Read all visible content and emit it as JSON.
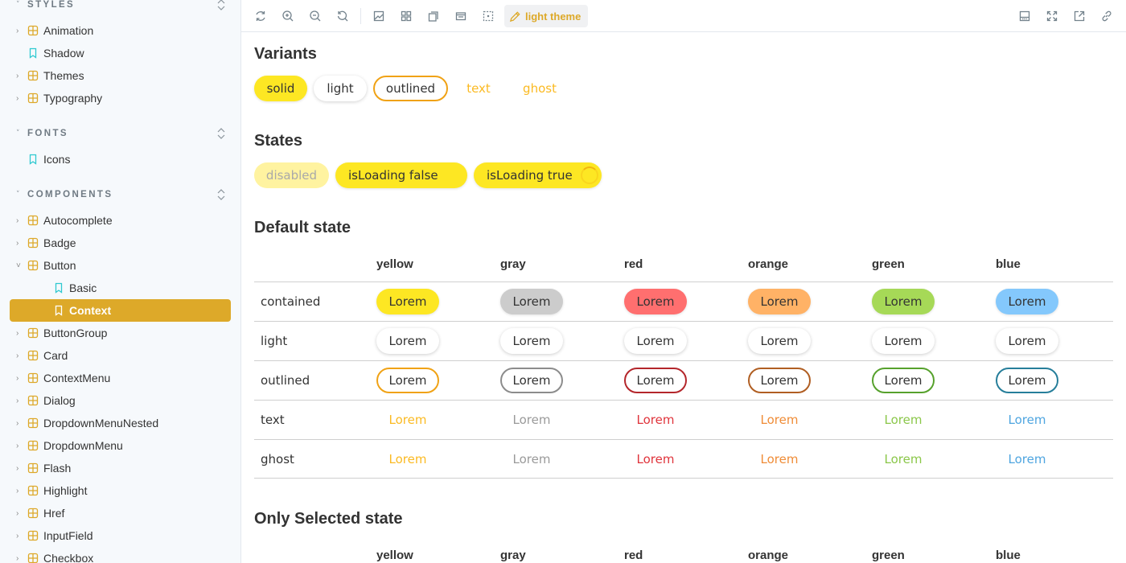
{
  "sidebar": {
    "sections": [
      {
        "title": "STYLES",
        "items": [
          {
            "label": "Animation",
            "type": "component",
            "expandable": true
          },
          {
            "label": "Shadow",
            "type": "story",
            "expandable": false
          },
          {
            "label": "Themes",
            "type": "component",
            "expandable": true
          },
          {
            "label": "Typography",
            "type": "component",
            "expandable": true
          }
        ]
      },
      {
        "title": "FONTS",
        "items": [
          {
            "label": "Icons",
            "type": "story",
            "expandable": false
          }
        ]
      },
      {
        "title": "COMPONENTS",
        "items": [
          {
            "label": "Autocomplete",
            "type": "component",
            "expandable": true
          },
          {
            "label": "Badge",
            "type": "component",
            "expandable": true
          },
          {
            "label": "Button",
            "type": "component",
            "expandable": true,
            "expanded": true
          },
          {
            "label": "Basic",
            "type": "story",
            "expandable": false,
            "child": true
          },
          {
            "label": "Context",
            "type": "story",
            "expandable": false,
            "child": true,
            "selected": true
          },
          {
            "label": "ButtonGroup",
            "type": "component",
            "expandable": true
          },
          {
            "label": "Card",
            "type": "component",
            "expandable": true
          },
          {
            "label": "ContextMenu",
            "type": "component",
            "expandable": true
          },
          {
            "label": "Dialog",
            "type": "component",
            "expandable": true
          },
          {
            "label": "DropdownMenuNested",
            "type": "component",
            "expandable": true
          },
          {
            "label": "DropdownMenu",
            "type": "component",
            "expandable": true
          },
          {
            "label": "Flash",
            "type": "component",
            "expandable": true
          },
          {
            "label": "Highlight",
            "type": "component",
            "expandable": true
          },
          {
            "label": "Href",
            "type": "component",
            "expandable": true
          },
          {
            "label": "InputField",
            "type": "component",
            "expandable": true
          },
          {
            "label": "Checkbox",
            "type": "component",
            "expandable": true
          }
        ]
      }
    ]
  },
  "toolbar": {
    "left_icons": [
      "reload-icon",
      "zoom-in-icon",
      "zoom-out-icon",
      "zoom-reset-icon",
      "background-icon",
      "grid-icon",
      "viewport-icon",
      "measure-icon",
      "outline-icon"
    ],
    "theme_label": "light theme",
    "right_icons": [
      "addons-panel-icon",
      "fullscreen-icon",
      "open-new-tab-icon",
      "copy-link-icon"
    ]
  },
  "main": {
    "variants": {
      "title": "Variants",
      "buttons": [
        "solid",
        "light",
        "outlined",
        "text",
        "ghost"
      ]
    },
    "states": {
      "title": "States",
      "buttons": [
        "disabled",
        "isLoading false",
        "isLoading true"
      ]
    },
    "default_state": {
      "title": "Default state",
      "columns": [
        "yellow",
        "gray",
        "red",
        "orange",
        "green",
        "blue"
      ],
      "rows": [
        "contained",
        "light",
        "outlined",
        "text",
        "ghost"
      ],
      "cell_label": "Lorem"
    },
    "only_selected_state": {
      "title": "Only Selected state",
      "columns": [
        "yellow",
        "gray",
        "red",
        "orange",
        "green",
        "blue"
      ]
    }
  },
  "colors": {
    "accent": "#dda929",
    "yellow": {
      "contained": "#fde723",
      "outline": "#f0a215",
      "text": "#fbba22"
    },
    "gray": {
      "contained": "#cccccc",
      "outline": "#8c8c8c",
      "text": "#9a9a9a"
    },
    "red": {
      "contained": "#ff6f6f",
      "outline": "#b4262b",
      "text": "#e0343c"
    },
    "orange": {
      "contained": "#ffb266",
      "outline": "#b05e22",
      "text": "#ef8c37"
    },
    "green": {
      "contained": "#a6d957",
      "outline": "#56a12c",
      "text": "#8bc74a"
    },
    "blue": {
      "contained": "#84c8fc",
      "outline": "#267e9a",
      "text": "#4ea5e0"
    }
  }
}
